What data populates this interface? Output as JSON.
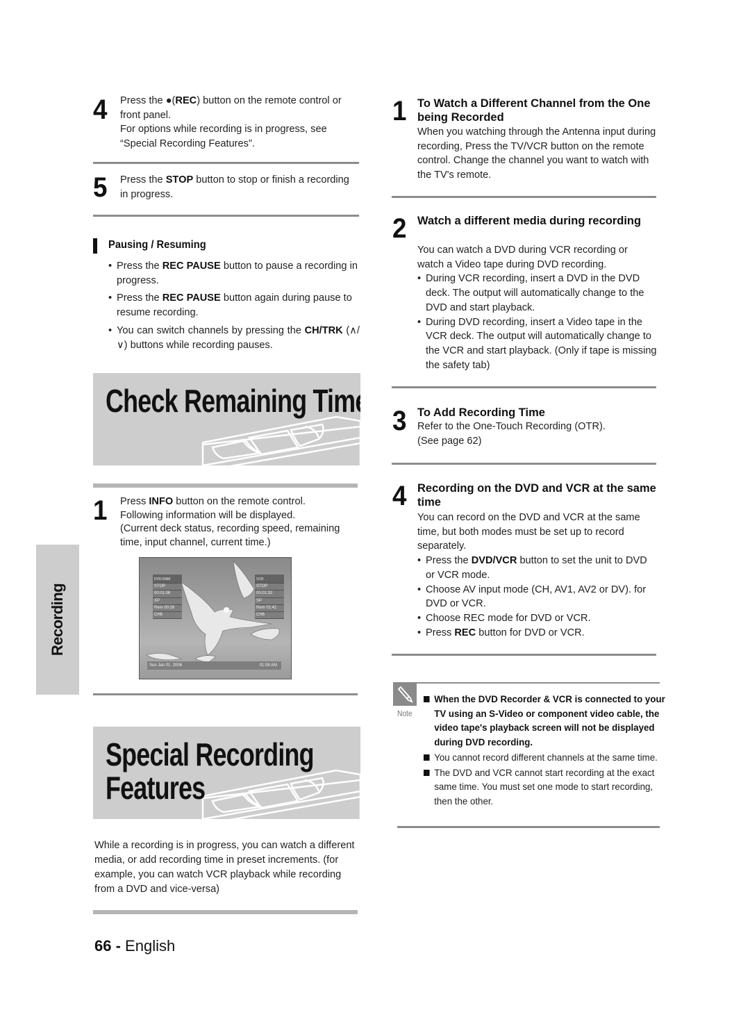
{
  "left": {
    "step4": {
      "number": "4",
      "pre": "Press the ",
      "rec_glyph": "●",
      "open": "(",
      "bold": "REC",
      "post": ") button on the remote control or front panel.",
      "extra": "For options while recording is in progress, see “Special Recording Features”."
    },
    "step5": {
      "number": "5",
      "pre": "Press the ",
      "bold": "STOP",
      "post": " button to stop or finish a recording in progress."
    },
    "pausing": {
      "title": "Pausing / Resuming",
      "bullets": [
        {
          "pre": "Press the ",
          "bold": "REC PAUSE",
          "post": " button to pause a recording in progress."
        },
        {
          "pre": "Press the ",
          "bold": "REC PAUSE",
          "post": " button again during pause to resume recording."
        },
        {
          "pre": "You can switch channels by pressing the ",
          "bold": "CH/TRK",
          "post": " (∧/∨) buttons while recording pauses."
        }
      ]
    },
    "check_banner": {
      "title": "Check Remaining Time",
      "icon": "vhs-cassette-icon"
    },
    "check_step1": {
      "number": "1",
      "pre": "Press ",
      "bold": "INFO",
      "post": " button on the remote control.",
      "line2": "Following information will be displayed.",
      "line3": "(Current deck status, recording speed, remaining time, input channel, current time.)"
    },
    "osd": {
      "dvd": {
        "header": "DVD-RAM",
        "status": "STOP",
        "time": "00:01:06",
        "speed": "XP",
        "remaining": "Rem 00:26",
        "channel": "CH6"
      },
      "vcr": {
        "header": "VCR",
        "status": "STOP",
        "time": "00:01:32",
        "speed": "SP",
        "remaining": "Rem 01:41",
        "channel": "CH6"
      },
      "date": "Sun Jan 01. 2006",
      "clock": "01:08 AM"
    },
    "special_banner": {
      "title_line1": "Special Recording",
      "title_line2": "Features",
      "icon": "vhs-cassette-icon"
    },
    "special_intro": "While a recording is in progress, you can watch a different media, or add recording time in preset increments. (for example, you can watch VCR playback while recording from a DVD and vice-versa)"
  },
  "side_tab": {
    "label": "Recording"
  },
  "right": {
    "item1": {
      "number": "1",
      "title": "To Watch a Different Channel from the One being Recorded",
      "body": "When you watching through the Antenna input during recording, Press the TV/VCR button on the remote control. Change the channel you want to watch with the TV's remote."
    },
    "item2": {
      "number": "2",
      "title": "Watch a different media during recording",
      "body": "You can watch a DVD during VCR recording or watch a Video tape during DVD recording.",
      "bullets": [
        "During VCR recording, insert a DVD in the DVD deck. The output will automatically change to the DVD and start playback.",
        "During DVD recording, insert a Video tape in the VCR deck. The output will automatically change to the VCR and start playback. (Only if tape is missing the safety tab)"
      ]
    },
    "item3": {
      "number": "3",
      "title": "To Add Recording Time",
      "body1": "Refer to the One-Touch Recording (OTR).",
      "body2": "(See page 62)"
    },
    "item4": {
      "number": "4",
      "title": "Recording on the DVD and VCR at the same time",
      "body": "You can record on the DVD and VCR at the same time, but both modes must be set up to record separately.",
      "bullets": [
        {
          "pre": "Press the ",
          "bold": "DVD/VCR",
          "post": " button to set the unit to DVD or VCR mode."
        },
        {
          "pre": "Choose AV input mode (CH, AV1, AV2 or DV). for DVD or VCR.",
          "bold": "",
          "post": ""
        },
        {
          "pre": "Choose REC mode for DVD or VCR.",
          "bold": "",
          "post": ""
        },
        {
          "pre": "Press ",
          "bold": "REC",
          "post": " button for DVD or VCR."
        }
      ]
    },
    "note": {
      "label": "Note",
      "icon": "pencil-icon",
      "items": [
        "When the DVD Recorder & VCR is connected to your TV using an S-Video or component video cable, the video tape's playback screen will not be displayed during DVD recording.",
        "You cannot record different channels at the same time.",
        "The DVD and VCR cannot start recording at the exact same time. You must set one mode to start recording, then the other."
      ]
    }
  },
  "footer": {
    "page_number": "66",
    "separator": " - ",
    "language": "English"
  }
}
